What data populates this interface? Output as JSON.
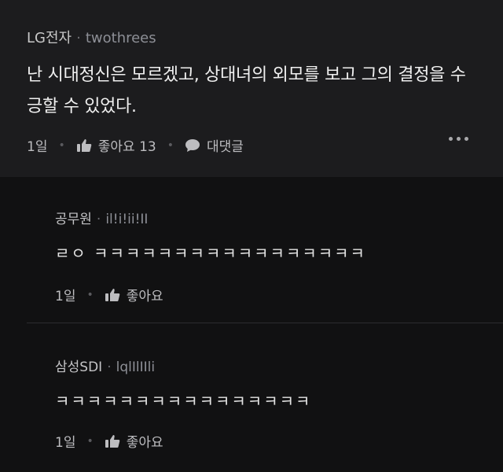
{
  "post": {
    "author": "LG전자",
    "separator": "·",
    "nickname": "twothrees",
    "body": "난 시대정신은 모르겠고, 상대녀의 외모를 보고 그의 결정을 수긍할 수 있었다.",
    "time": "1일",
    "like_label": "좋아요",
    "like_count": "13",
    "reply_label": "대댓글",
    "more_icon": "more-horizontal-icon"
  },
  "replies": [
    {
      "author": "공무원",
      "separator": "·",
      "nickname": "il!i!ii!II",
      "body": "ㄹㅇ ㅋㅋㅋㅋㅋㅋㅋㅋㅋㅋㅋㅋㅋㅋㅋㅋㅋ",
      "time": "1일",
      "like_label": "좋아요"
    },
    {
      "author": "삼성SDI",
      "separator": "·",
      "nickname": "lqlIlIIli",
      "body": "ㅋㅋㅋㅋㅋㅋㅋㅋㅋㅋㅋㅋㅋㅋㅋㅋ",
      "time": "1일",
      "like_label": "좋아요"
    }
  ],
  "colors": {
    "background": "#111112",
    "post_background": "#1c1c1e",
    "text": "#f0f0f0",
    "muted": "#8d8f96"
  }
}
